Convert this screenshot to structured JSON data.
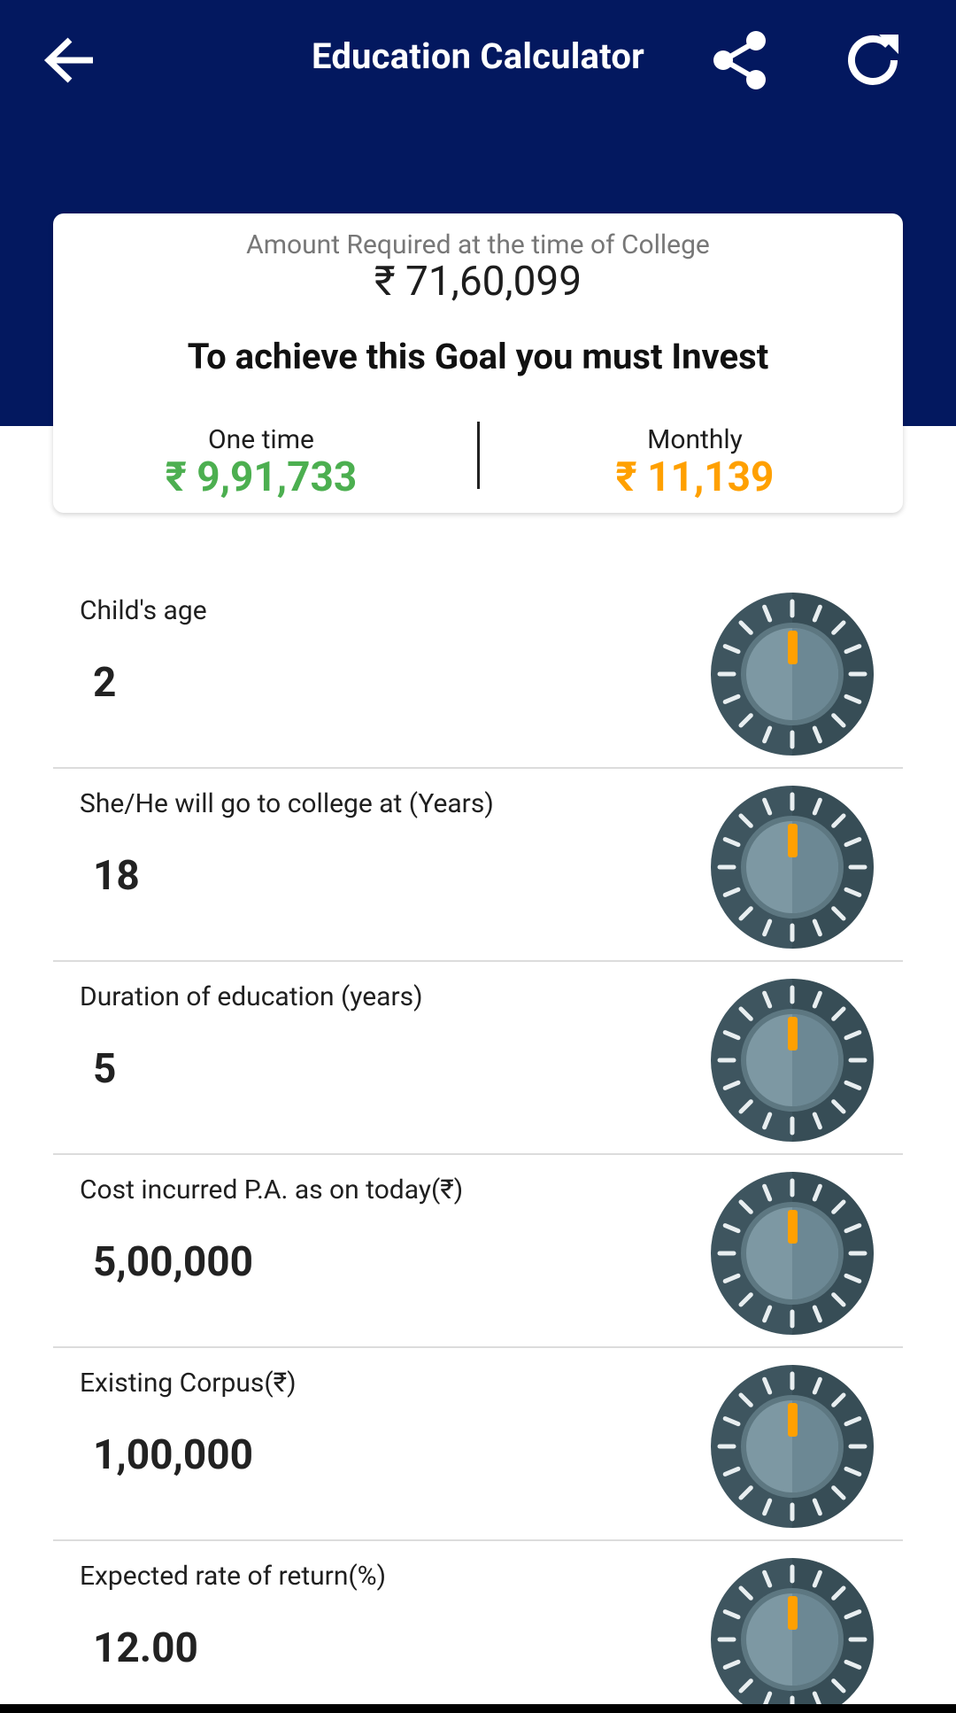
{
  "header": {
    "title": "Education Calculator",
    "bg_color": "#03185f",
    "back_icon": "arrow-left-icon",
    "share_icon": "share-icon",
    "refresh_icon": "refresh-icon"
  },
  "summary": {
    "amount_label": "Amount Required at the time of College",
    "amount_value": "₹ 71,60,099",
    "goal_text": "To achieve this Goal you must Invest",
    "one_time": {
      "label": "One time",
      "value": "₹ 9,91,733",
      "color": "#4caf50"
    },
    "monthly": {
      "label": "Monthly",
      "value": "₹ 11,139",
      "color": "#ffa000"
    }
  },
  "inputs": [
    {
      "label": "Child's age",
      "value": "2"
    },
    {
      "label": "She/He will go to college at (Years)",
      "value": "18"
    },
    {
      "label": "Duration of education (years)",
      "value": "5"
    },
    {
      "label": "Cost incurred P.A. as on today(₹)",
      "value": "5,00,000"
    },
    {
      "label": "Existing Corpus(₹)",
      "value": "1,00,000"
    },
    {
      "label": "Expected rate of return(%)",
      "value": "12.00"
    }
  ],
  "knob_icon": "dial-knob-icon",
  "knob_colors": {
    "outer": "#3e555f",
    "inner": "#7d98a3",
    "indicator": "#ffa000"
  }
}
